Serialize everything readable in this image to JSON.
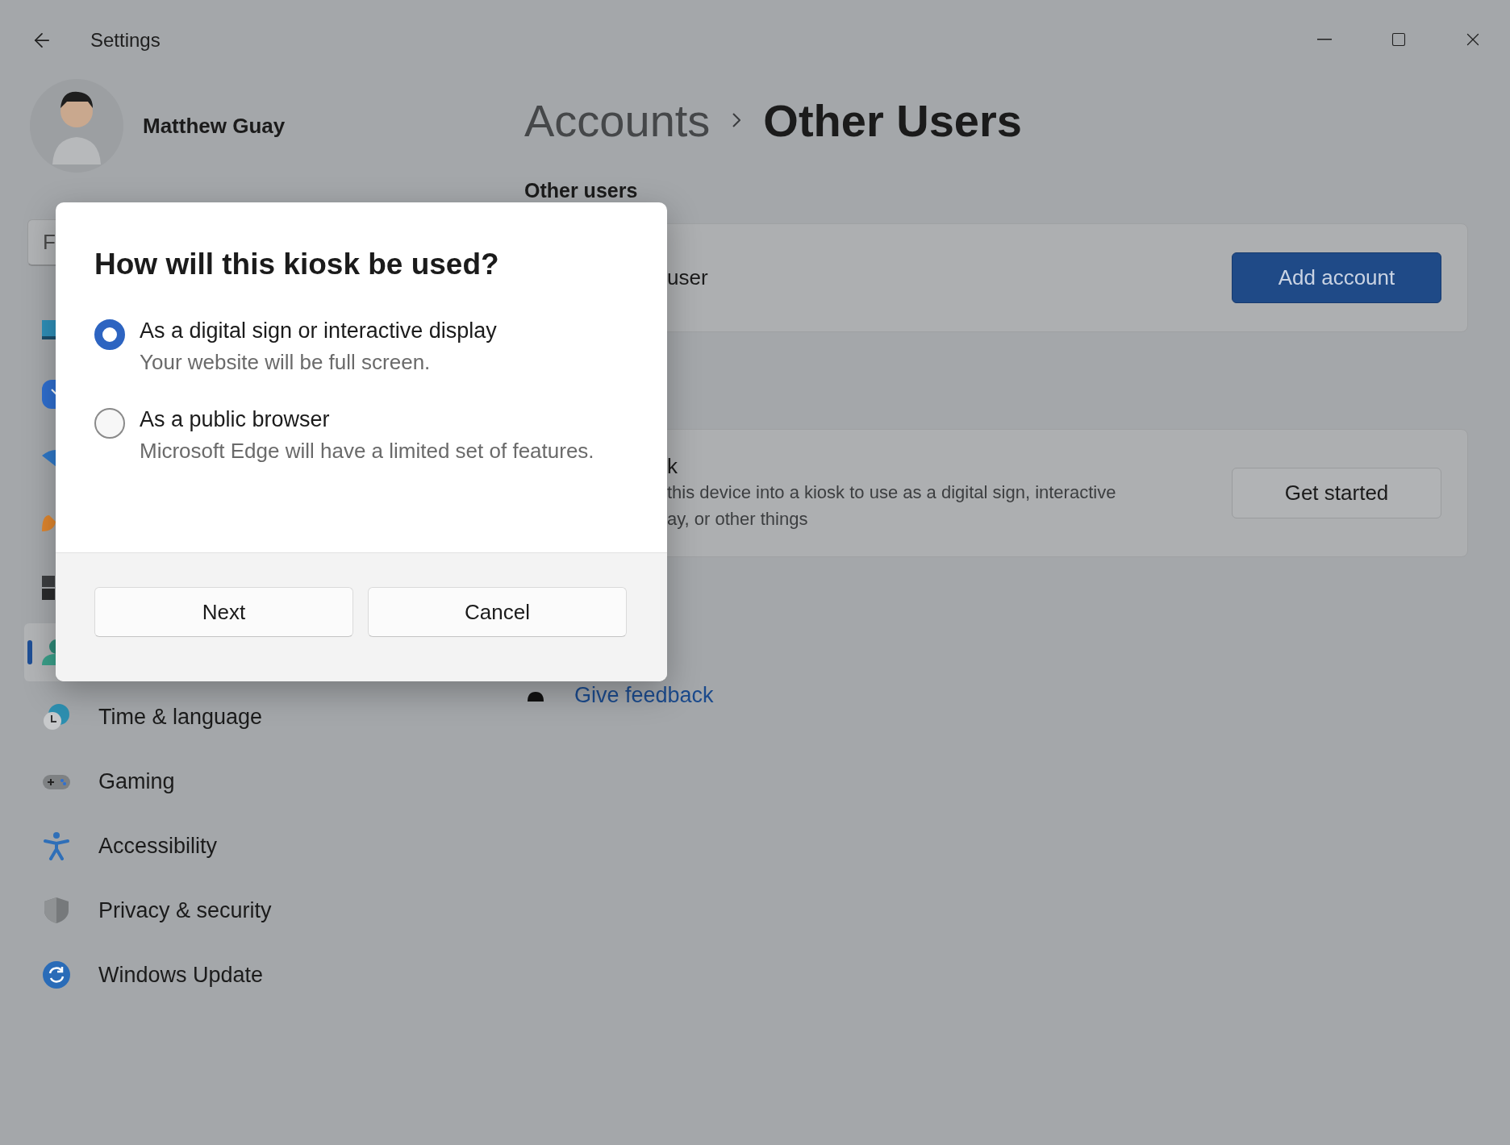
{
  "window": {
    "title": "Settings"
  },
  "profile": {
    "name": "Matthew Guay"
  },
  "search": {
    "placeholder": "F"
  },
  "sidebar": {
    "items": [
      {
        "selected": false
      },
      {
        "selected": false
      },
      {
        "selected": false
      },
      {
        "selected": false
      },
      {
        "selected": false
      },
      {
        "selected": true
      },
      {
        "label": "Time & language",
        "selected": false
      },
      {
        "label": "Gaming",
        "selected": false
      },
      {
        "label": "Accessibility",
        "selected": false
      },
      {
        "label": "Privacy & security",
        "selected": false
      },
      {
        "label": "Windows Update",
        "selected": false
      }
    ]
  },
  "breadcrumb": {
    "parent": "Accounts",
    "current": "Other Users"
  },
  "section_header": "Other users",
  "cards": [
    {
      "title": "user",
      "button": {
        "label": "Add account",
        "kind": "primary"
      }
    },
    {
      "title": "k",
      "description_lines": [
        "this device into a kiosk to use as a digital sign, interactive",
        "ay, or other things"
      ],
      "button": {
        "label": "Get started",
        "kind": "secondary"
      }
    }
  ],
  "links": [
    {
      "label": "Give feedback"
    }
  ],
  "dialog": {
    "title": "How will this kiosk be used?",
    "options": [
      {
        "label": "As a digital sign or interactive display",
        "description": "Your website will be full screen.",
        "selected": true
      },
      {
        "label": "As a public browser",
        "description": "Microsoft Edge will have a limited set of features.",
        "selected": false
      }
    ],
    "buttons": [
      {
        "label": "Next"
      },
      {
        "label": "Cancel"
      }
    ]
  }
}
